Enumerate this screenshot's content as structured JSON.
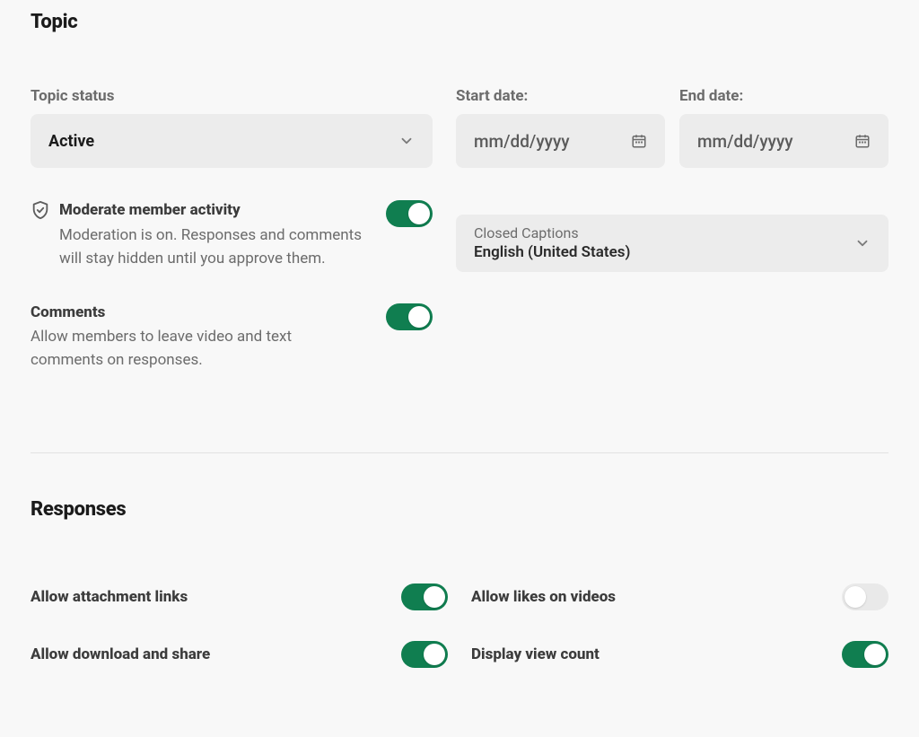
{
  "topic": {
    "heading": "Topic",
    "status_label": "Topic status",
    "status_value": "Active",
    "start_date_label": "Start date:",
    "start_date_placeholder": "mm/dd/yyyy",
    "end_date_label": "End date:",
    "end_date_placeholder": "mm/dd/yyyy",
    "moderate": {
      "title": "Moderate member activity",
      "desc": "Moderation is on. Responses and comments will stay hidden until you approve them.",
      "on": true
    },
    "comments": {
      "title": "Comments",
      "desc": "Allow members to leave video and text comments on responses.",
      "on": true
    },
    "captions": {
      "label": "Closed Captions",
      "value": "English (United States)"
    }
  },
  "responses": {
    "heading": "Responses",
    "items": [
      {
        "label": "Allow attachment links",
        "on": true
      },
      {
        "label": "Allow likes on videos",
        "on": false
      },
      {
        "label": "Allow download and share",
        "on": true
      },
      {
        "label": "Display view count",
        "on": true
      }
    ]
  }
}
